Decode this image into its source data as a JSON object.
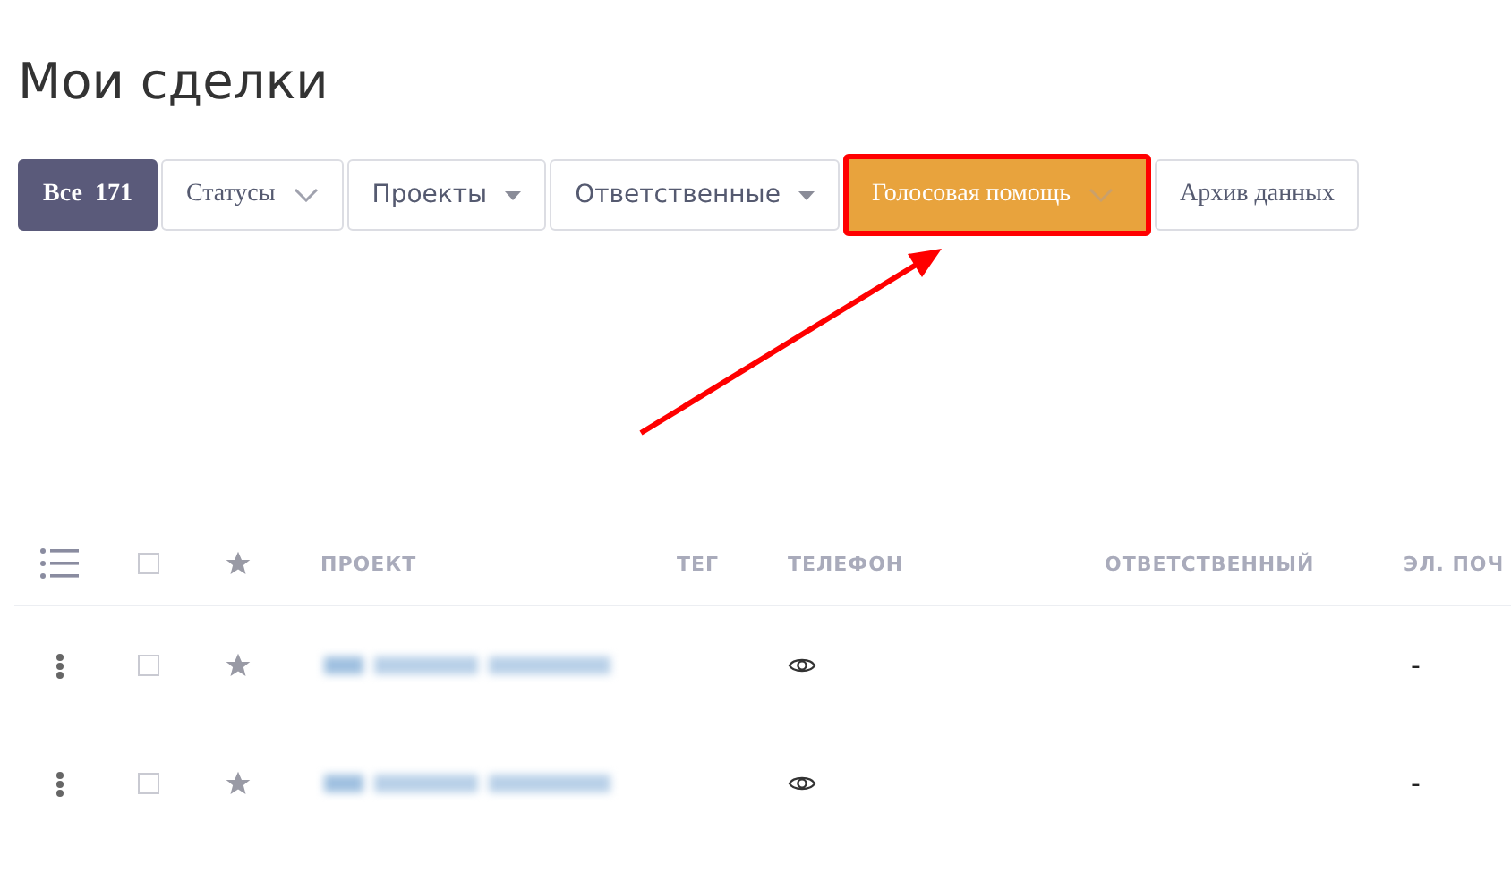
{
  "title": "Мои сделки",
  "filters": [
    {
      "label": "Все",
      "count": "171",
      "kind": "plain",
      "selected": true,
      "highlighted": false
    },
    {
      "label": "Статусы",
      "kind": "chevron",
      "selected": false,
      "highlighted": false
    },
    {
      "label": "Проекты",
      "kind": "caret",
      "selected": false,
      "highlighted": false
    },
    {
      "label": "Ответственные",
      "kind": "caret",
      "selected": false,
      "highlighted": false
    },
    {
      "label": "Голосовая помощь",
      "kind": "chevron",
      "selected": false,
      "highlighted": true
    },
    {
      "label": "Архив данных",
      "kind": "plain",
      "selected": false,
      "highlighted": false
    }
  ],
  "table": {
    "all_checked": false,
    "columns": [
      "ПРОЕКТ",
      "ТЕГ",
      "ТЕЛЕФОН",
      "ОТВЕТСТВЕННЫЙ",
      "ЭЛ. ПОЧ"
    ],
    "rows": [
      {
        "checked": false,
        "email": "-"
      },
      {
        "checked": false,
        "email": "-"
      }
    ]
  }
}
